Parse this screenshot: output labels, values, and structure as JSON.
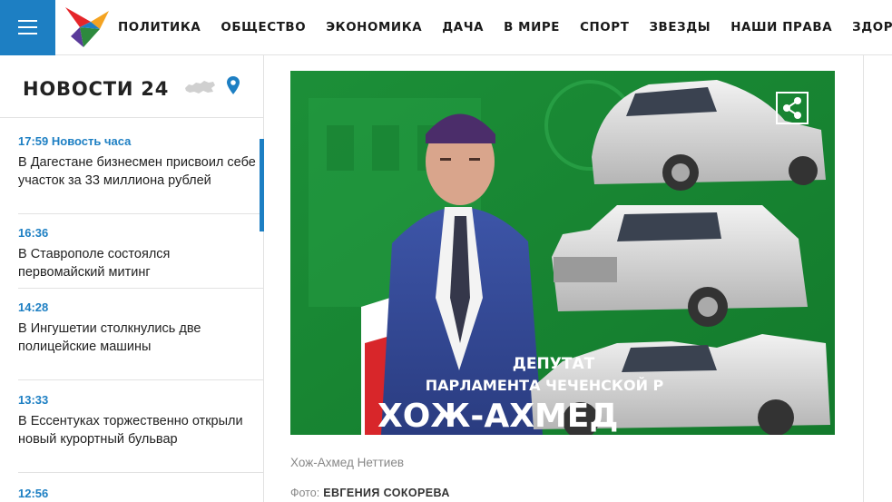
{
  "nav": {
    "items": [
      "ПОЛИТИКА",
      "ОБЩЕСТВО",
      "ЭКОНОМИКА",
      "ДАЧА",
      "В МИРЕ",
      "СПОРТ",
      "ЗВЕЗДЫ",
      "НАШИ ПРАВА",
      "ЗДОРОВЬЕ"
    ]
  },
  "sidebar": {
    "title": "НОВОСТИ 24",
    "news": [
      {
        "time": "17:59 Новость часа",
        "text": "В Дагестане бизнесмен присвоил себе участок за 33 миллиона рублей"
      },
      {
        "time": "16:36",
        "text": "В Ставрополе состоялся первомайский митинг"
      },
      {
        "time": "14:28",
        "text": "В Ингушетии столкнулись две полицейские машины"
      },
      {
        "time": "13:33",
        "text": "В Ессентуках торжественно открыли новый курортный бульвар"
      },
      {
        "time": "12:56",
        "text": ""
      }
    ]
  },
  "article": {
    "photo_text": {
      "line1": "ДЕПУТАТ",
      "line2": "ПАРЛАМЕНТА ЧЕЧЕНСКОЙ Р",
      "line3": "ХОЖ-АХМЕД"
    },
    "caption": "Хож-Ахмед Неттиев",
    "credit_label": "Фото:",
    "credit_name": "ЕВГЕНИЯ СОКОРЕВА"
  },
  "colors": {
    "accent": "#1d7fc3",
    "photo_bg": "#1f9a3c"
  },
  "icons": {
    "menu": "hamburger-icon",
    "location": "map-pin-icon",
    "share": "share-icon",
    "region": "russia-map-icon"
  }
}
